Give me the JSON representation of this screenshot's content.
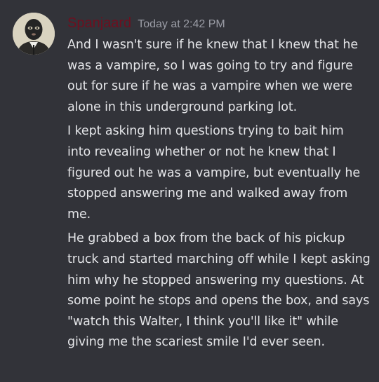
{
  "message": {
    "author": "Spanjaard",
    "timestamp": "Today at 2:42 PM",
    "colors": {
      "background": "#323339",
      "author": "#6e0f1f",
      "timestamp": "#9a9ca5",
      "text": "#e4e5e8"
    },
    "avatar_icon": "balaclava-avatar-icon",
    "paragraphs": [
      "And I wasn't sure if he knew that I knew that he was a vampire, so I was going to try and figure out for sure if he was a vampire when we were alone in this underground parking lot.",
      "I kept asking him questions trying to bait him into revealing whether or not he knew that I figured out he was a vampire, but eventually he stopped answering me and walked away from me.",
      "He grabbed a box from the back of his pickup truck and started marching off while I kept asking him why he stopped answering my questions. At some point he stops and opens the box, and says \"watch this Walter, I think you'll like it\" while giving me the scariest smile I'd ever seen."
    ]
  }
}
